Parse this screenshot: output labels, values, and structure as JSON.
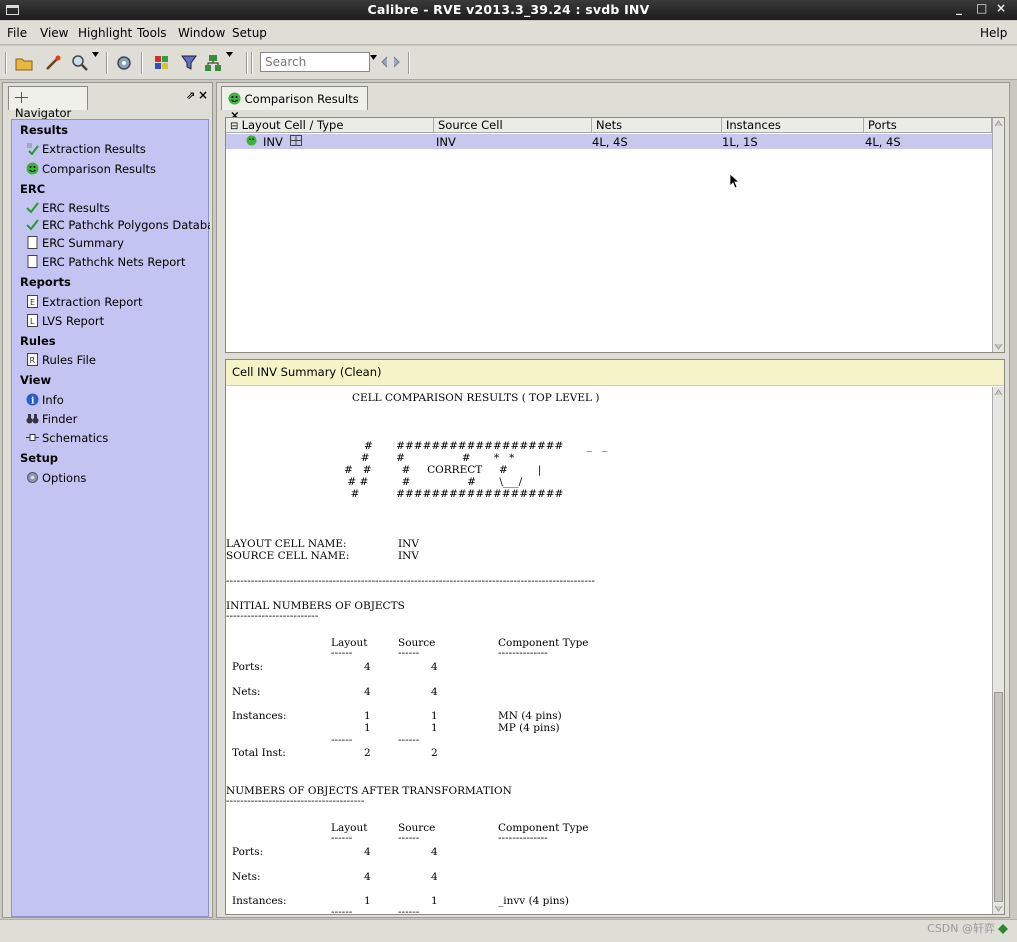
{
  "window": {
    "title": "Calibre - RVE v2013.3_39.24 : svdb INV",
    "minimize": "_",
    "maximize": "□",
    "close": "×"
  },
  "menubar": {
    "file": "File",
    "view": "View",
    "highlight": "Highlight",
    "tools": "Tools",
    "window": "Window",
    "setup": "Setup",
    "help": "Help"
  },
  "toolbar": {
    "search_placeholder": "Search",
    "icons": [
      "folder-icon",
      "wand-icon",
      "zoom-icon",
      "settings-icon",
      "layers-icon",
      "filter-icon",
      "network-icon"
    ]
  },
  "navigator": {
    "tab_label": "Navigator",
    "sections": {
      "results": "Results",
      "erc": "ERC",
      "reports": "Reports",
      "rules": "Rules",
      "view": "View",
      "setup": "Setup"
    },
    "items": {
      "extraction_results": "Extraction Results",
      "comparison_results": "Comparison Results",
      "erc_results": "ERC Results",
      "erc_pathchk_polygons": "ERC Pathchk Polygons Databa",
      "erc_summary": "ERC Summary",
      "erc_pathchk_nets": "ERC Pathchk Nets Report",
      "extraction_report": "Extraction Report",
      "lvs_report": "LVS Report",
      "rules_file": "Rules File",
      "info": "Info",
      "finder": "Finder",
      "schematics": "Schematics",
      "options": "Options"
    }
  },
  "comparison": {
    "tab_label": "Comparison Results",
    "tab_close": "×",
    "columns": {
      "layout_cell": "Layout Cell / Type",
      "source_cell": "Source Cell",
      "nets": "Nets",
      "instances": "Instances",
      "ports": "Ports"
    },
    "row": {
      "layout_cell": "INV",
      "source_cell": "INV",
      "nets": "4L, 4S",
      "instances": "1L, 1S",
      "ports": "4L, 4S"
    }
  },
  "summary": {
    "title": "Cell INV Summary (Clean)",
    "header": "CELL COMPARISON RESULTS ( TOP LEVEL )",
    "banner_art": [
      "      #       ###################       _   _",
      "     #        #                 #       *   *",
      "#   #         #     CORRECT     #         |",
      " # #          #                 #       \\___/",
      "  #           ###################"
    ],
    "layout_cell_name_label": "LAYOUT CELL NAME:",
    "layout_cell_name": "INV",
    "source_cell_name_label": "SOURCE CELL NAME:",
    "source_cell_name": "INV",
    "separator": "--------------------------------------------------------------------------------------------------------",
    "initial_heading": "INITIAL NUMBERS OF OBJECTS",
    "initial_underline": "--------------------------",
    "after_heading": "NUMBERS OF OBJECTS AFTER TRANSFORMATION",
    "after_underline": "---------------------------------------",
    "col_layout": "Layout",
    "col_source": "Source",
    "col_component": "Component Type",
    "col_dash_short": "------",
    "col_dash_comp": "--------------",
    "initial_rows": [
      {
        "label": "Ports:",
        "layout": "4",
        "source": "4",
        "component": ""
      },
      {
        "label": "Nets:",
        "layout": "4",
        "source": "4",
        "component": ""
      },
      {
        "label": "Instances:",
        "layout": "1",
        "source": "1",
        "component": "MN (4 pins)"
      },
      {
        "label": "",
        "layout": "1",
        "source": "1",
        "component": "MP (4 pins)"
      },
      {
        "label": "Total Inst:",
        "layout": "2",
        "source": "2",
        "component": ""
      }
    ],
    "after_rows": [
      {
        "label": "Ports:",
        "layout": "4",
        "source": "4",
        "component": ""
      },
      {
        "label": "Nets:",
        "layout": "4",
        "source": "4",
        "component": ""
      },
      {
        "label": "Instances:",
        "layout": "1",
        "source": "1",
        "component": "_invv (4 pins)"
      }
    ]
  },
  "watermark": "CSDN @轩弈"
}
